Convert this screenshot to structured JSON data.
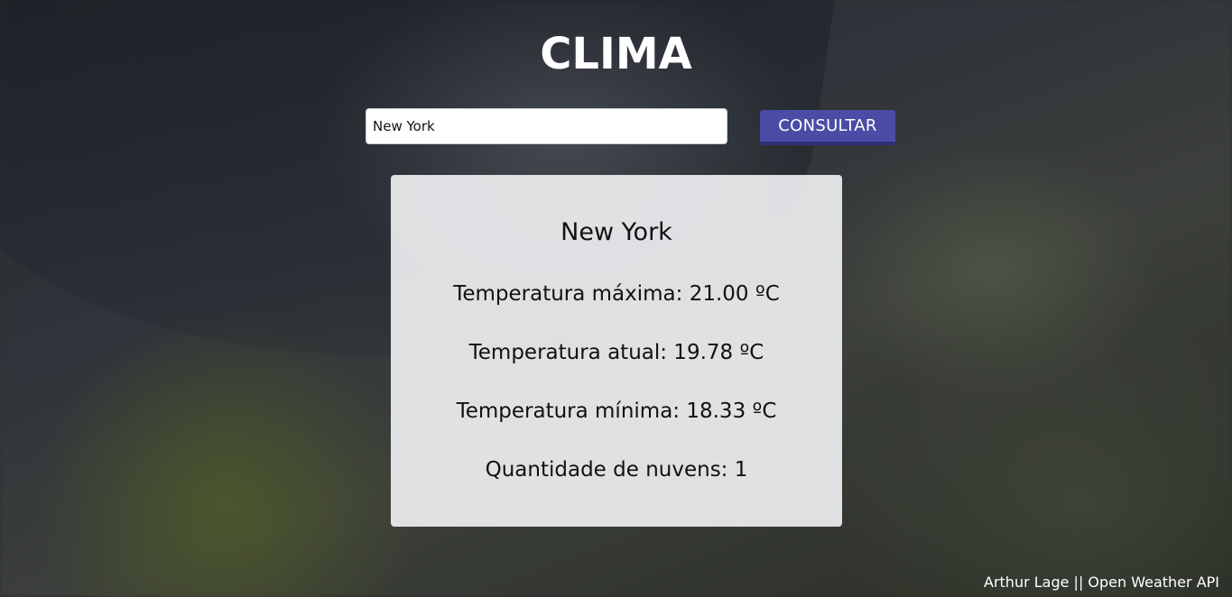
{
  "header": {
    "title": "CLIMA"
  },
  "search": {
    "value": "New York",
    "button_label": "CONSULTAR"
  },
  "result": {
    "city": "New York",
    "max_temp": "Temperatura máxima: 21.00 ºC",
    "current_temp": "Temperatura atual: 19.78 ºC",
    "min_temp": "Temperatura mínima: 18.33 ºC",
    "clouds": "Quantidade de nuvens: 1"
  },
  "footer": {
    "credit": "Arthur Lage || Open Weather API"
  },
  "colors": {
    "button": "#4a4ca6",
    "button_border": "#2f3178",
    "card": "#eeeff1",
    "text": "#ffffff"
  }
}
